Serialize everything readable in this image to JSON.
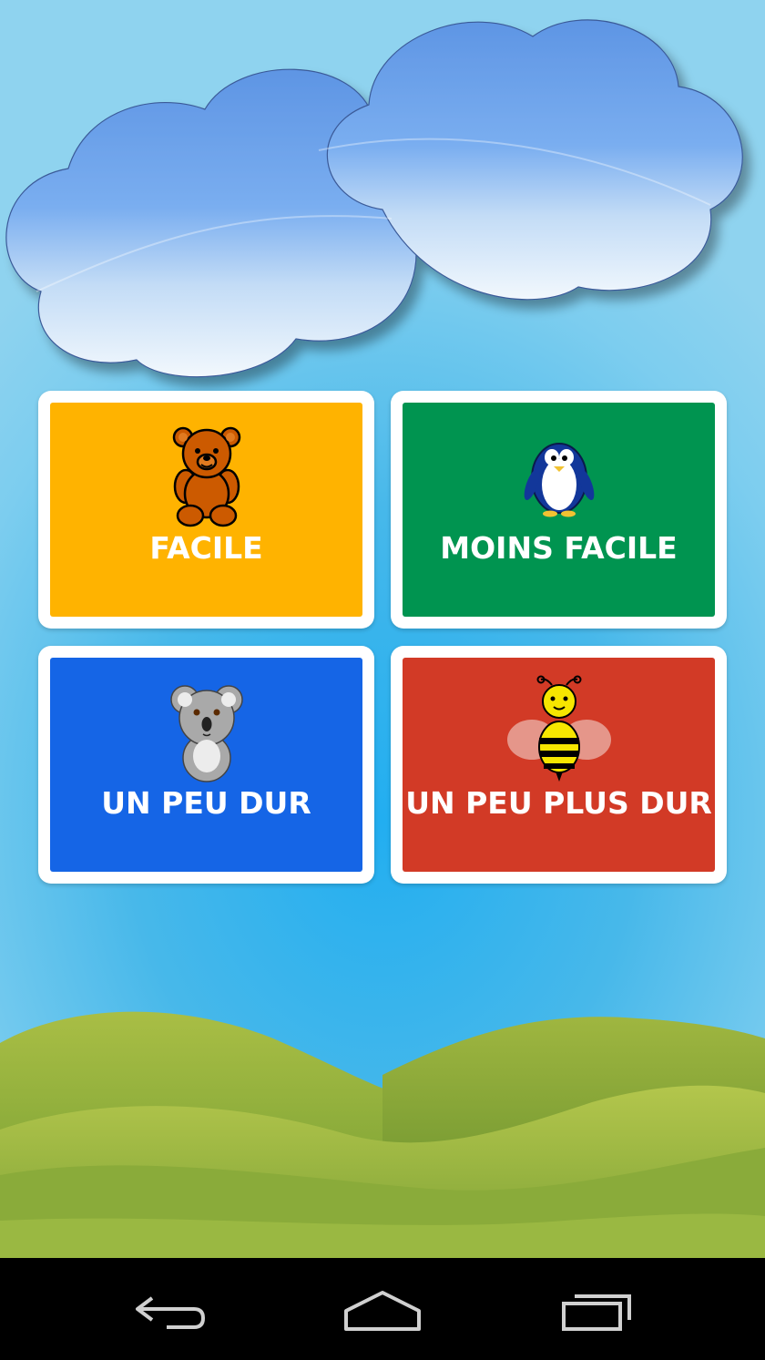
{
  "levels": [
    {
      "label": "FACILE",
      "color": "#FFB300",
      "icon": "teddy-bear-icon"
    },
    {
      "label": "MOINS FACILE",
      "color": "#009450",
      "icon": "penguin-icon"
    },
    {
      "label": "UN PEU DUR",
      "color": "#1565E6",
      "icon": "koala-icon"
    },
    {
      "label": "UN PEU PLUS DUR",
      "color": "#D23A26",
      "icon": "bee-icon"
    }
  ],
  "navigation_bar": {
    "back_icon": "back-arrow-icon",
    "home_icon": "home-icon",
    "recents_icon": "recent-apps-icon"
  }
}
